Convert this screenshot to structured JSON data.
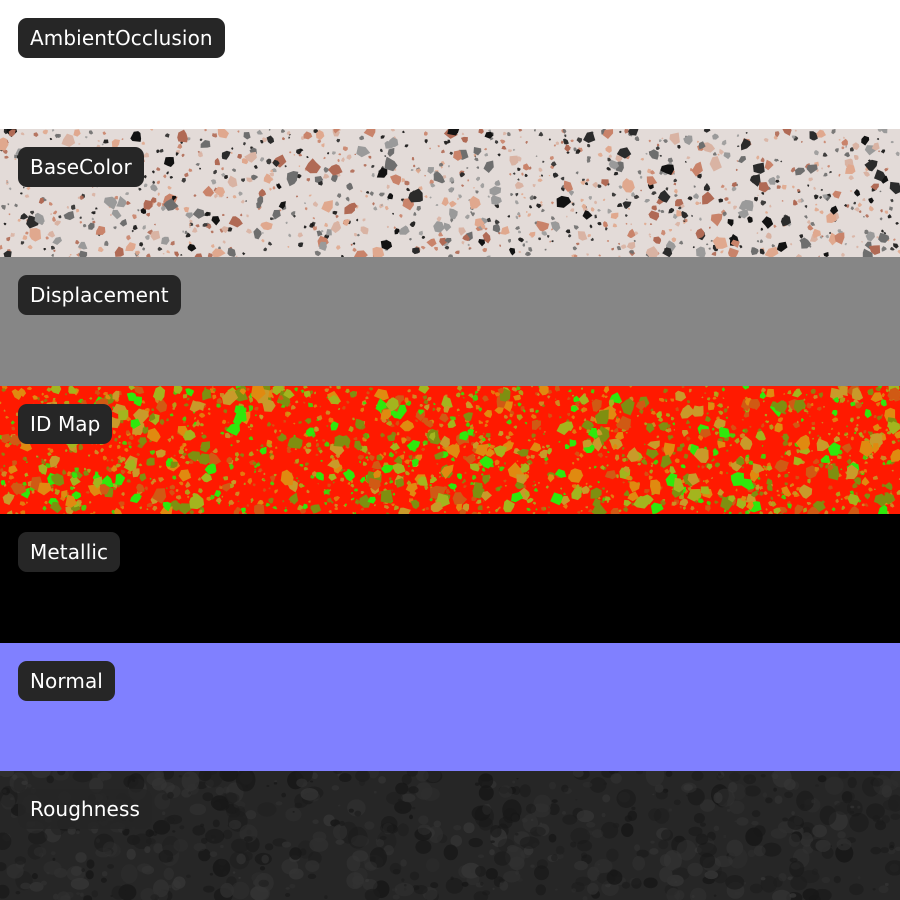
{
  "maps": [
    {
      "label": "AmbientOcclusion",
      "texture": "flat",
      "base": "#ffffff"
    },
    {
      "label": "BaseColor",
      "texture": "terrazzo",
      "base": "#e3dbd8",
      "chips": [
        "#c9836a",
        "#b06a55",
        "#e0a88e",
        "#2b2b2b",
        "#6e6e6e",
        "#9a9a9a",
        "#d9b3a3",
        "#121212"
      ]
    },
    {
      "label": "Displacement",
      "texture": "flat",
      "base": "#868686"
    },
    {
      "label": "ID Map",
      "texture": "idmap",
      "base": "#ff1a00",
      "chips": [
        "#c99a2a",
        "#e08a10",
        "#a3b51e",
        "#2fe80c",
        "#d05a14",
        "#7f8f10"
      ]
    },
    {
      "label": "Metallic",
      "texture": "flat",
      "base": "#000000"
    },
    {
      "label": "Normal",
      "texture": "flat",
      "base": "#8080ff"
    },
    {
      "label": "Roughness",
      "texture": "speckle",
      "base": "#262626",
      "chips": [
        "#1c1c1c",
        "#303030",
        "#171717",
        "#353535"
      ]
    }
  ]
}
